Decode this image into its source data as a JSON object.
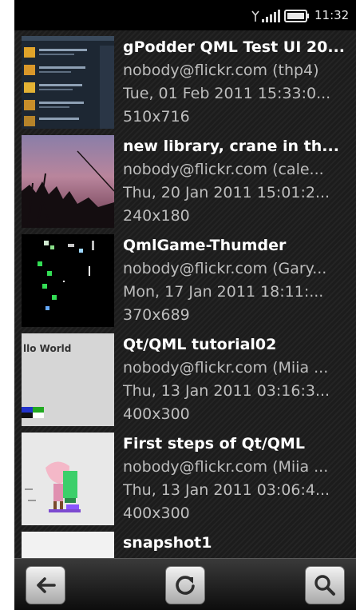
{
  "status_bar": {
    "time": "11:32",
    "signal_icon": "signal-bars-icon",
    "battery_icon": "battery-icon"
  },
  "photos": [
    {
      "title": "gPodder QML Test UI 20...",
      "author": "nobody@flickr.com (thp4)",
      "date": "Tue, 01 Feb 2011 15:33:0...",
      "size": "510x716",
      "thumb_caption": ""
    },
    {
      "title": "new library, crane in th...",
      "author": "nobody@flickr.com (cale...",
      "date": "Thu, 20 Jan 2011 15:01:2...",
      "size": "240x180",
      "thumb_caption": ""
    },
    {
      "title": "QmlGame-Thumder",
      "author": "nobody@flickr.com (Gary...",
      "date": "Mon, 17 Jan 2011 18:11:...",
      "size": "370x689",
      "thumb_caption": ""
    },
    {
      "title": "Qt/QML tutorial02",
      "author": "nobody@flickr.com (Miia ...",
      "date": "Thu, 13 Jan 2011 03:16:3...",
      "size": "400x300",
      "thumb_caption": "llo World"
    },
    {
      "title": "First steps of Qt/QML",
      "author": "nobody@flickr.com (Miia ...",
      "date": "Thu, 13 Jan 2011 03:06:4...",
      "size": "400x300",
      "thumb_caption": ""
    },
    {
      "title": "snapshot1",
      "author": "",
      "date": "",
      "size": "",
      "thumb_caption": ""
    }
  ],
  "toolbar": {
    "back_icon": "back-arrow-icon",
    "refresh_icon": "refresh-icon",
    "search_icon": "search-icon"
  },
  "colors": {
    "background": "#1c1c1c",
    "title_text": "#ffffff",
    "secondary_text": "#bdbdbd"
  }
}
